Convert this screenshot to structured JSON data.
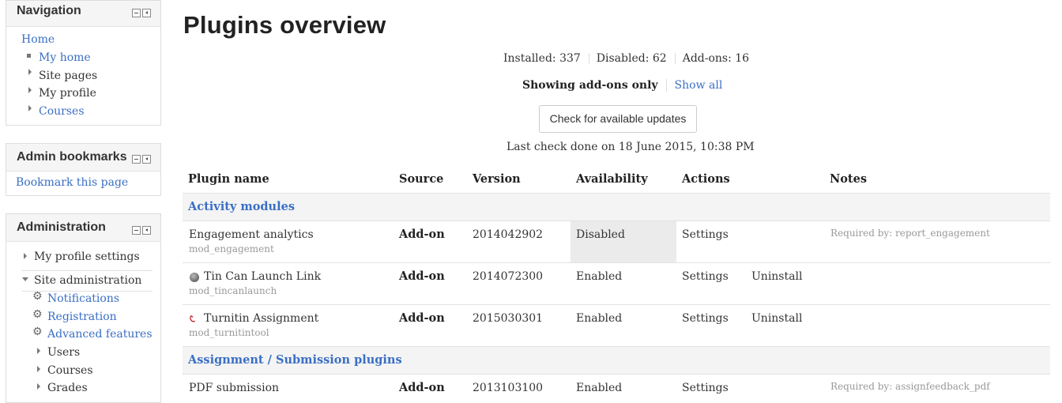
{
  "sidebar": {
    "navigation": {
      "title": "Navigation",
      "home": "Home",
      "items": [
        {
          "label": "My home"
        },
        {
          "label": "Site pages"
        },
        {
          "label": "My profile"
        },
        {
          "label": "Courses"
        }
      ]
    },
    "admin_bookmarks": {
      "title": "Admin bookmarks",
      "link": "Bookmark this page"
    },
    "administration": {
      "title": "Administration",
      "my_profile_settings": "My profile settings",
      "site_administration": "Site administration",
      "items": [
        {
          "label": "Notifications",
          "icon": "gear-icon"
        },
        {
          "label": "Registration",
          "icon": "gear-icon"
        },
        {
          "label": "Advanced features",
          "icon": "gear-icon"
        },
        {
          "label": "Users"
        },
        {
          "label": "Courses"
        },
        {
          "label": "Grades"
        }
      ]
    }
  },
  "main": {
    "title": "Plugins overview",
    "stats": {
      "installed": "Installed: 337",
      "disabled": "Disabled: 62",
      "addons": "Add-ons: 16"
    },
    "filter": {
      "current": "Showing add-ons only",
      "show_all": "Show all"
    },
    "check_button": "Check for available updates",
    "last_check": "Last check done on 18 June 2015, 10:38 PM",
    "table": {
      "headers": [
        "Plugin name",
        "Source",
        "Version",
        "Availability",
        "Actions",
        "Notes"
      ],
      "categories": [
        "Activity modules",
        "Assignment / Submission plugins"
      ],
      "rows": [
        {
          "name": "Engagement analytics",
          "component": "mod_engagement",
          "source": "Add-on",
          "version": "2014042902",
          "availability": "Disabled",
          "settings": "Settings",
          "uninstall": "",
          "notes": "Required by: report_engagement"
        },
        {
          "name": "Tin Can Launch Link",
          "component": "mod_tincanlaunch",
          "source": "Add-on",
          "version": "2014072300",
          "availability": "Enabled",
          "settings": "Settings",
          "uninstall": "Uninstall",
          "notes": ""
        },
        {
          "name": "Turnitin Assignment",
          "component": "mod_turnitintool",
          "source": "Add-on",
          "version": "2015030301",
          "availability": "Enabled",
          "settings": "Settings",
          "uninstall": "Uninstall",
          "notes": ""
        },
        {
          "name": "PDF submission",
          "component": "",
          "source": "Add-on",
          "version": "2013103100",
          "availability": "Enabled",
          "settings": "Settings",
          "uninstall": "",
          "notes": "Required by: assignfeedback_pdf"
        }
      ]
    }
  },
  "colors": {
    "link": "#3a6fc4",
    "disabled_cell": "#ebebeb",
    "header_bg": "#f5f5f5"
  }
}
